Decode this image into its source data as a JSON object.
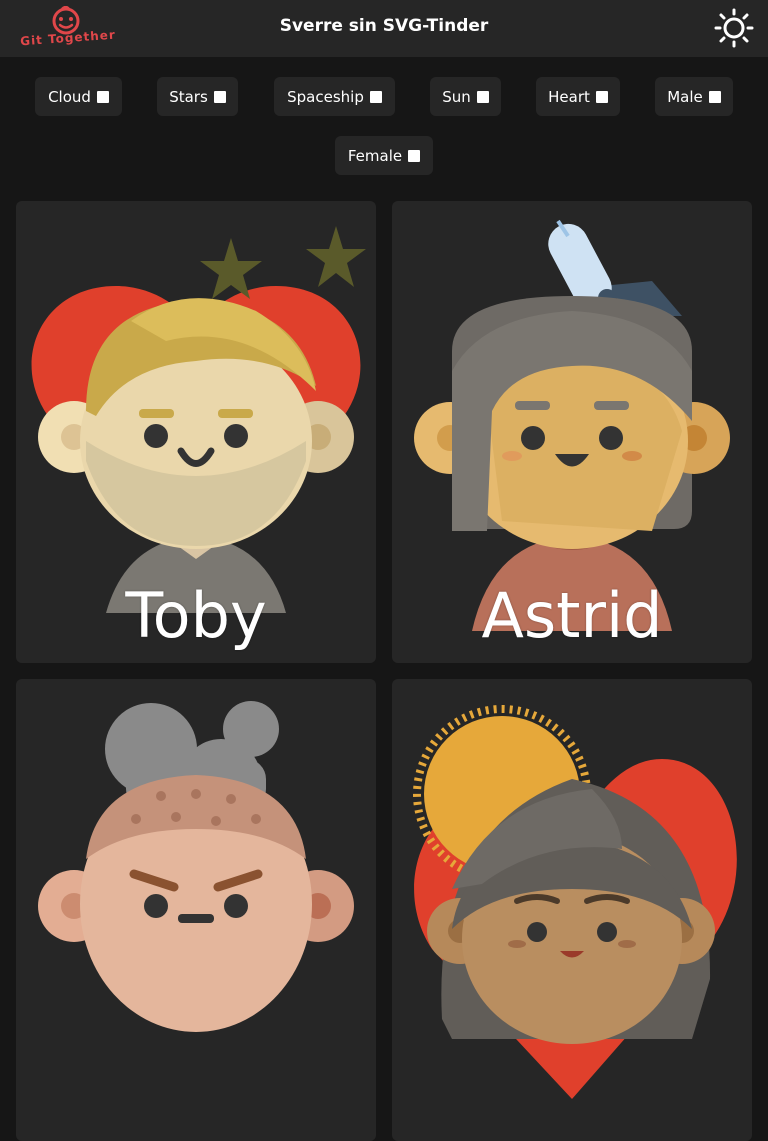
{
  "header": {
    "logo_text": "Git Together",
    "title": "Sverre sin SVG-Tinder",
    "theme_icon": "sun-icon"
  },
  "filters": [
    {
      "label": "Cloud",
      "checked": false
    },
    {
      "label": "Stars",
      "checked": false
    },
    {
      "label": "Spaceship",
      "checked": false
    },
    {
      "label": "Sun",
      "checked": false
    },
    {
      "label": "Heart",
      "checked": false
    },
    {
      "label": "Male",
      "checked": false
    },
    {
      "label": "Female",
      "checked": false
    }
  ],
  "profiles": [
    {
      "name": "Toby",
      "gender": "male",
      "accessories": [
        "heart",
        "stars"
      ]
    },
    {
      "name": "Astrid",
      "gender": "female",
      "accessories": [
        "spaceship"
      ]
    },
    {
      "name": "",
      "gender": "male",
      "accessories": [
        "cloud"
      ]
    },
    {
      "name": "",
      "gender": "female",
      "accessories": [
        "sun",
        "heart"
      ]
    }
  ],
  "colors": {
    "background": "#161616",
    "surface": "#262626",
    "brand": "#e0474a",
    "heart": "#e0402c",
    "star": "#5a5a2a",
    "sun": "#e6a83a"
  }
}
